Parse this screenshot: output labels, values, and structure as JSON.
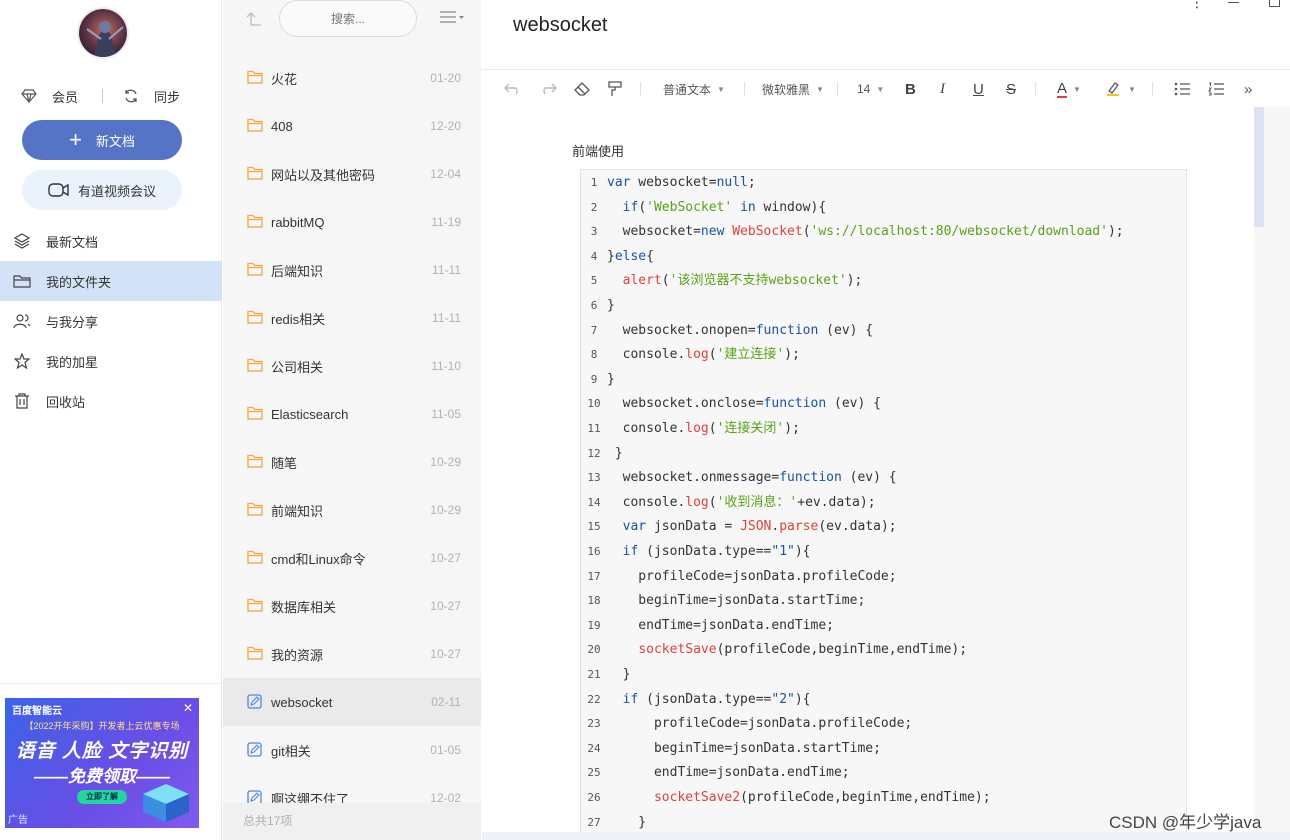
{
  "sidebar": {
    "vip_label": "会员",
    "sync_label": "同步",
    "new_doc_label": "新文档",
    "meeting_label": "有道视频会议",
    "nav": [
      {
        "label": "最新文档",
        "icon": "layers-icon",
        "active": false
      },
      {
        "label": "我的文件夹",
        "icon": "folder-icon",
        "active": true
      },
      {
        "label": "与我分享",
        "icon": "share-users-icon",
        "active": false
      },
      {
        "label": "我的加星",
        "icon": "star-icon",
        "active": false
      },
      {
        "label": "回收站",
        "icon": "trash-icon",
        "active": false
      }
    ],
    "ad": {
      "brand": "百度智能云",
      "subtitle": "【2022开年采购】开发者上云优惠专场",
      "headline": "语音 人脸 文字识别",
      "subheadline": "——免费领取——",
      "button": "立即了解",
      "label": "广告"
    }
  },
  "filelist": {
    "search_placeholder": "搜索...",
    "items": [
      {
        "name": "火花",
        "date": "01-20",
        "type": "folder"
      },
      {
        "name": "408",
        "date": "12-20",
        "type": "folder"
      },
      {
        "name": "网站以及其他密码",
        "date": "12-04",
        "type": "folder"
      },
      {
        "name": "rabbitMQ",
        "date": "11-19",
        "type": "folder"
      },
      {
        "name": "后端知识",
        "date": "11-11",
        "type": "folder"
      },
      {
        "name": "redis相关",
        "date": "11-11",
        "type": "folder"
      },
      {
        "name": "公司相关",
        "date": "11-10",
        "type": "folder"
      },
      {
        "name": "Elasticsearch",
        "date": "11-05",
        "type": "folder"
      },
      {
        "name": "随笔",
        "date": "10-29",
        "type": "folder"
      },
      {
        "name": "前端知识",
        "date": "10-29",
        "type": "folder"
      },
      {
        "name": "cmd和Linux命令",
        "date": "10-27",
        "type": "folder"
      },
      {
        "name": "数据库相关",
        "date": "10-27",
        "type": "folder"
      },
      {
        "name": "我的资源",
        "date": "10-27",
        "type": "folder"
      },
      {
        "name": "websocket",
        "date": "02-11",
        "type": "note",
        "selected": true
      },
      {
        "name": "git相关",
        "date": "01-05",
        "type": "note"
      },
      {
        "name": "啊这绷不住了",
        "date": "12-02",
        "type": "note"
      }
    ],
    "footer": "总共17项"
  },
  "editor": {
    "title": "websocket",
    "toolbar": {
      "paragraph_style": "普通文本",
      "font_family": "微软雅黑",
      "font_size": "14",
      "bold": "B",
      "italic": "I",
      "underline": "U",
      "strike": "S",
      "font_color": "A",
      "more": "»"
    },
    "section_label": "前端使用",
    "code_lines": [
      [
        [
          "kw",
          "var"
        ],
        [
          "p",
          " websocket="
        ],
        [
          "kw",
          "null"
        ],
        [
          "p",
          ";"
        ]
      ],
      [
        [
          "p",
          "  "
        ],
        [
          "kw",
          "if"
        ],
        [
          "p",
          "("
        ],
        [
          "str",
          "'WebSocket'"
        ],
        [
          "p",
          " "
        ],
        [
          "kw",
          "in"
        ],
        [
          "p",
          " window){"
        ]
      ],
      [
        [
          "p",
          "  websocket="
        ],
        [
          "kw",
          "new"
        ],
        [
          "p",
          " "
        ],
        [
          "fn",
          "WebSocket"
        ],
        [
          "p",
          "("
        ],
        [
          "str",
          "'ws://localhost:80/websocket/download'"
        ],
        [
          "p",
          ");"
        ]
      ],
      [
        [
          "p",
          "}"
        ],
        [
          "kw",
          "else"
        ],
        [
          "p",
          "{"
        ]
      ],
      [
        [
          "p",
          "  "
        ],
        [
          "fn",
          "alert"
        ],
        [
          "p",
          "("
        ],
        [
          "str",
          "'该浏览器不支持websocket'"
        ],
        [
          "p",
          ");"
        ]
      ],
      [
        [
          "p",
          "}"
        ]
      ],
      [
        [
          "p",
          "  websocket.onopen="
        ],
        [
          "kw",
          "function"
        ],
        [
          "p",
          " (ev) {"
        ]
      ],
      [
        [
          "p",
          "  console."
        ],
        [
          "fn",
          "log"
        ],
        [
          "p",
          "("
        ],
        [
          "str",
          "'建立连接'"
        ],
        [
          "p",
          ");"
        ]
      ],
      [
        [
          "p",
          "}"
        ]
      ],
      [
        [
          "p",
          "  websocket.onclose="
        ],
        [
          "kw",
          "function"
        ],
        [
          "p",
          " (ev) {"
        ]
      ],
      [
        [
          "p",
          "  console."
        ],
        [
          "fn",
          "log"
        ],
        [
          "p",
          "("
        ],
        [
          "str",
          "'连接关闭'"
        ],
        [
          "p",
          ");"
        ]
      ],
      [
        [
          "p",
          " }"
        ]
      ],
      [
        [
          "p",
          "  websocket.onmessage="
        ],
        [
          "kw",
          "function"
        ],
        [
          "p",
          " (ev) {"
        ]
      ],
      [
        [
          "p",
          "  console."
        ],
        [
          "fn",
          "log"
        ],
        [
          "p",
          "("
        ],
        [
          "str",
          "'收到消息：'"
        ],
        [
          "p",
          "+ev.data);"
        ]
      ],
      [
        [
          "p",
          "  "
        ],
        [
          "kw",
          "var"
        ],
        [
          "p",
          " jsonData = "
        ],
        [
          "fn",
          "JSON"
        ],
        [
          "p",
          "."
        ],
        [
          "fn",
          "parse"
        ],
        [
          "p",
          "(ev.data);"
        ]
      ],
      [
        [
          "p",
          "  "
        ],
        [
          "kw",
          "if"
        ],
        [
          "p",
          " (jsonData.type=="
        ],
        [
          "num",
          "\"1\""
        ],
        [
          "p",
          "){"
        ]
      ],
      [
        [
          "p",
          "    profileCode=jsonData.profileCode;"
        ]
      ],
      [
        [
          "p",
          "    beginTime=jsonData.startTime;"
        ]
      ],
      [
        [
          "p",
          "    endTime=jsonData.endTime;"
        ]
      ],
      [
        [
          "p",
          "    "
        ],
        [
          "fn",
          "socketSave"
        ],
        [
          "p",
          "(profileCode,beginTime,endTime);"
        ]
      ],
      [
        [
          "p",
          "  }"
        ]
      ],
      [
        [
          "p",
          "  "
        ],
        [
          "kw",
          "if"
        ],
        [
          "p",
          " (jsonData.type=="
        ],
        [
          "num",
          "\"2\""
        ],
        [
          "p",
          "){"
        ]
      ],
      [
        [
          "p",
          "      profileCode=jsonData.profileCode;"
        ]
      ],
      [
        [
          "p",
          "      beginTime=jsonData.startTime;"
        ]
      ],
      [
        [
          "p",
          "      endTime=jsonData.endTime;"
        ]
      ],
      [
        [
          "p",
          "      "
        ],
        [
          "fn",
          "socketSave2"
        ],
        [
          "p",
          "(profileCode,beginTime,endTime);"
        ]
      ],
      [
        [
          "p",
          "    }"
        ]
      ]
    ]
  },
  "watermark": "CSDN @年少学java",
  "colors": {
    "accent": "#5574c6",
    "nav_active": "#d3e2f7",
    "keyword": "#1a52a0",
    "function": "#e0403b",
    "string": "#5aa217",
    "folder": "#f0a640"
  }
}
